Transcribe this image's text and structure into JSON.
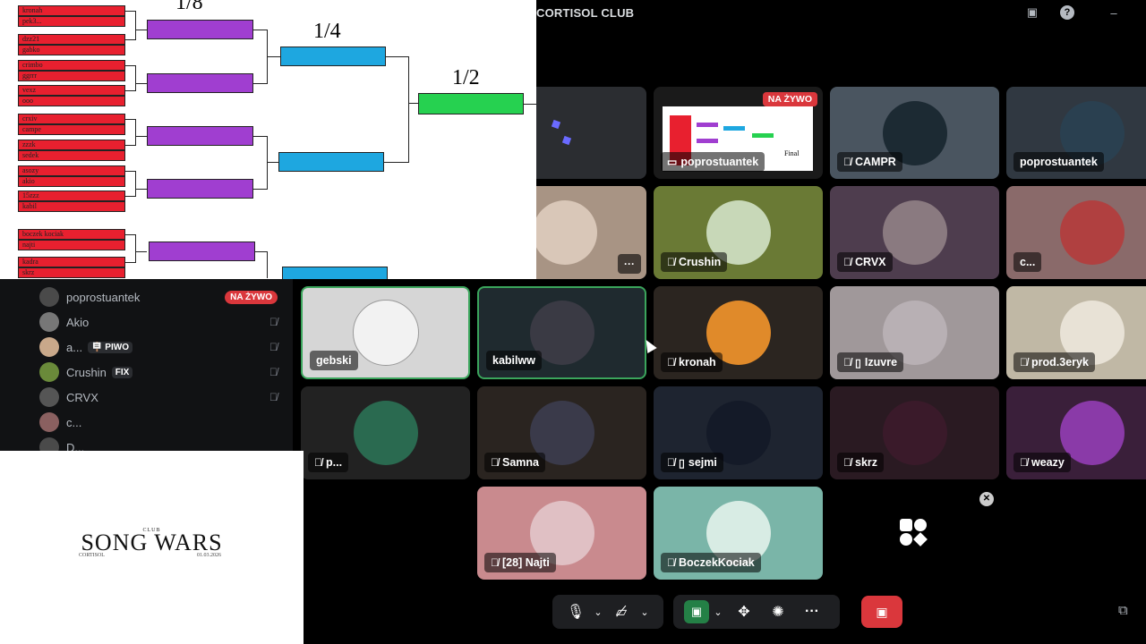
{
  "window": {
    "title": "CORTISOL CLUB"
  },
  "bracket": {
    "round_labels": [
      "1/8",
      "1/4",
      "1/2"
    ],
    "final_label": "Final",
    "slots": [
      "kronah",
      "pek3...",
      "dzz21",
      "gabko",
      "crimbo",
      "ggrrr",
      "vexz",
      "ooo",
      "crxiv",
      "campe",
      "zzzk",
      "sedek",
      "asozy",
      "akio",
      "15zzz",
      "kabil",
      "boczek kociak",
      "najti",
      "kadra",
      "skrz"
    ]
  },
  "members": [
    {
      "name": "poprostuantek",
      "badge": "NA ŻYWO",
      "avatar_color": "#4a4a4a"
    },
    {
      "name": "Akio",
      "avatar_color": "#777"
    },
    {
      "name": "a...",
      "tag": "🪧 PIWO",
      "avatar_color": "#c9a88a"
    },
    {
      "name": "Crushin",
      "tag": "FIX",
      "avatar_color": "#6a8a3a"
    },
    {
      "name": "CRVX",
      "avatar_color": "#555"
    },
    {
      "name": "c...",
      "avatar_color": "#8a6060"
    },
    {
      "name": "D...",
      "avatar_color": "#4a4a4a"
    }
  ],
  "songwars": {
    "club": "CLUB",
    "title": "SONG WARS",
    "left": "CORTISOL",
    "right": "01.03.2026"
  },
  "tiles": [
    {
      "name": "",
      "bg": "#2b2d31"
    },
    {
      "name": "poprostuantek",
      "live": "NA ŻYWO",
      "bg": "#1a1a1a"
    },
    {
      "name": "CAMPR",
      "muted": true,
      "bg": "#4a5560"
    },
    {
      "name": "poprostuantek",
      "bg": "#303841"
    },
    {
      "name": "",
      "bg": "#a89484",
      "menu": "···"
    },
    {
      "name": "Crushin",
      "muted": true,
      "bg": "#6a7a35"
    },
    {
      "name": "CRVX",
      "muted": true,
      "bg": "#4e3d4e"
    },
    {
      "name": "c...",
      "bg": "#8a6a6a"
    },
    {
      "name": "gebski",
      "bg": "#d6d6d6"
    },
    {
      "name": "kabilww",
      "bg": "#1f2a2f"
    },
    {
      "name": "kronah",
      "muted": true,
      "bg": "#2b2520"
    },
    {
      "name": "Izuvre",
      "muted": true,
      "mobile": true,
      "bg": "#a0989a"
    },
    {
      "name": "prod.3eryk",
      "muted": true,
      "bg": "#c0b8a5"
    },
    {
      "name": "p...",
      "muted": true,
      "bg": "#222"
    },
    {
      "name": "Samna",
      "muted": true,
      "bg": "#2a2420"
    },
    {
      "name": "sejmi",
      "muted": true,
      "mobile": true,
      "bg": "#1e2430"
    },
    {
      "name": "skrz",
      "muted": true,
      "bg": "#2a1a22"
    },
    {
      "name": "weazy",
      "muted": true,
      "bg": "#3a1f3a"
    },
    {
      "name": "[28] Najti",
      "muted": true,
      "bg": "#c98a8e"
    },
    {
      "name": "BoczekKociak",
      "muted": true,
      "bg": "#7ab5a8"
    }
  ],
  "controls": {
    "close": "✕"
  }
}
